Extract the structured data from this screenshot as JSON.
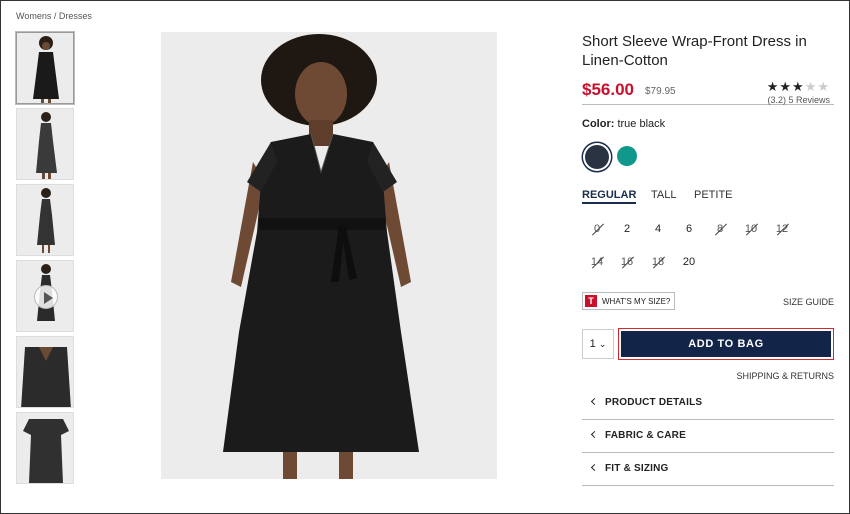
{
  "breadcrumb": "Womens / Dresses",
  "product": {
    "title": "Short Sleeve Wrap-Front Dress in Linen-Cotton",
    "price": "$56.00",
    "original_price": "$79.95",
    "rating": 3.2,
    "rating_text": "(3.2) 5 Reviews",
    "stars": [
      "★",
      "★",
      "★",
      "★",
      "★"
    ]
  },
  "thumbnails": [
    {
      "name": "front",
      "active": true
    },
    {
      "name": "side"
    },
    {
      "name": "full"
    },
    {
      "name": "video",
      "has_play": true
    },
    {
      "name": "detail"
    },
    {
      "name": "flat"
    }
  ],
  "color": {
    "label": "Color:",
    "value": "true black",
    "swatches": [
      {
        "name": "true black",
        "hex": "#2a3342",
        "selected": true
      },
      {
        "name": "teal",
        "hex": "#10998a"
      }
    ]
  },
  "fit_tabs": [
    "REGULAR",
    "TALL",
    "PETITE"
  ],
  "sizes": [
    {
      "label": "0",
      "available": false
    },
    {
      "label": "2",
      "available": true
    },
    {
      "label": "4",
      "available": true
    },
    {
      "label": "6",
      "available": true
    },
    {
      "label": "8",
      "available": false
    },
    {
      "label": "10",
      "available": false
    },
    {
      "label": "12",
      "available": false
    },
    {
      "label": "14",
      "available": false
    },
    {
      "label": "16",
      "available": false
    },
    {
      "label": "18",
      "available": false
    },
    {
      "label": "20",
      "available": true
    }
  ],
  "whats_my_size": {
    "icon": "T",
    "label": "WHAT'S MY SIZE?"
  },
  "size_guide": "SIZE GUIDE",
  "quantity": "1",
  "quantity_chevron": "⌄",
  "add_to_bag": "ADD TO BAG",
  "shipping": "SHIPPING & RETURNS",
  "accordions": [
    "PRODUCT DETAILS",
    "FABRIC & CARE",
    "FIT & SIZING"
  ],
  "colors": {
    "price_red": "#c8102e",
    "navy": "#122448",
    "focus_red": "#d9262c"
  }
}
